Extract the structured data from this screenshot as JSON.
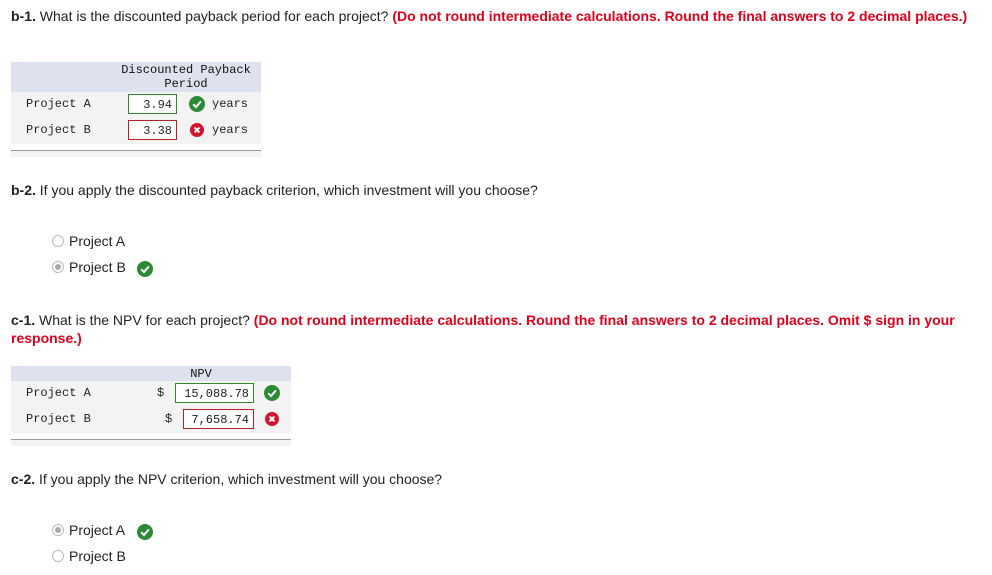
{
  "b1": {
    "number": "b-1.",
    "text": " What is the discounted payback period for each project? ",
    "instruction": "(Do not round intermediate calculations. Round the final answers to 2 decimal places.)",
    "header_line1": "Discounted Payback",
    "header_line2": "Period",
    "rows": [
      {
        "label": "Project A",
        "value": "3.94",
        "units": "years",
        "status": "correct"
      },
      {
        "label": "Project B",
        "value": "3.38",
        "units": "years",
        "status": "incorrect"
      }
    ]
  },
  "b2": {
    "number": "b-2.",
    "text": " If you apply the discounted payback criterion, which investment will you choose?",
    "options": [
      {
        "label": "Project A",
        "selected": false
      },
      {
        "label": "Project B",
        "selected": true,
        "status": "correct"
      }
    ]
  },
  "c1": {
    "number": "c-1.",
    "text": " What is the NPV for each project? ",
    "instruction": "(Do not round intermediate calculations. Round the final answers to 2 decimal places. Omit $ sign in your response.)",
    "header": "NPV",
    "currency": "$",
    "rows": [
      {
        "label": "Project A",
        "value": "15,088.78",
        "status": "correct"
      },
      {
        "label": "Project B",
        "value": "7,658.74",
        "status": "incorrect"
      }
    ]
  },
  "c2": {
    "number": "c-2.",
    "text": " If you apply the NPV criterion, which investment will you choose?",
    "options": [
      {
        "label": "Project A",
        "selected": true,
        "status": "correct"
      },
      {
        "label": "Project B",
        "selected": false
      }
    ]
  },
  "colors": {
    "correct": "#2d8a34",
    "incorrect": "#d1172e",
    "instruction": "#e0001b",
    "header_bg": "#dde2ee"
  },
  "icons": {
    "correct": "check-circle-icon",
    "incorrect": "x-circle-icon"
  }
}
